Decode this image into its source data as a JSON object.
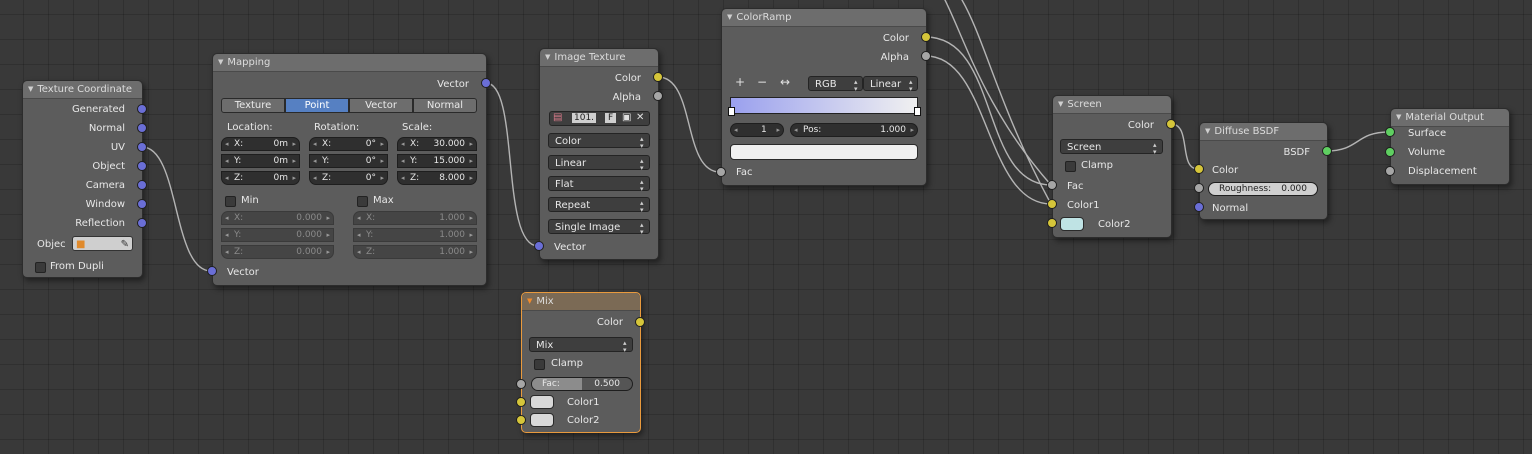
{
  "texture_coordinate": {
    "title": "Texture Coordinate",
    "outputs": [
      "Generated",
      "Normal",
      "UV",
      "Object",
      "Camera",
      "Window",
      "Reflection"
    ],
    "object_label": "Objec",
    "from_dupli_label": "From Dupli"
  },
  "mapping": {
    "title": "Mapping",
    "output": "Vector",
    "types": [
      "Texture",
      "Point",
      "Vector",
      "Normal"
    ],
    "selected_type": "Point",
    "location_label": "Location:",
    "rotation_label": "Rotation:",
    "scale_label": "Scale:",
    "location": [
      {
        "axis": "X:",
        "value": "0m"
      },
      {
        "axis": "Y:",
        "value": "0m"
      },
      {
        "axis": "Z:",
        "value": "0m"
      }
    ],
    "rotation": [
      {
        "axis": "X:",
        "value": "0°"
      },
      {
        "axis": "Y:",
        "value": "0°"
      },
      {
        "axis": "Z:",
        "value": "0°"
      }
    ],
    "scale": [
      {
        "axis": "X:",
        "value": "30.000"
      },
      {
        "axis": "Y:",
        "value": "15.000"
      },
      {
        "axis": "Z:",
        "value": "8.000"
      }
    ],
    "min_label": "Min",
    "max_label": "Max",
    "min": [
      {
        "axis": "X:",
        "value": "0.000"
      },
      {
        "axis": "Y:",
        "value": "0.000"
      },
      {
        "axis": "Z:",
        "value": "0.000"
      }
    ],
    "max": [
      {
        "axis": "X:",
        "value": "1.000"
      },
      {
        "axis": "Y:",
        "value": "1.000"
      },
      {
        "axis": "Z:",
        "value": "1.000"
      }
    ],
    "input": "Vector"
  },
  "image_texture": {
    "title": "Image Texture",
    "outputs": [
      "Color",
      "Alpha"
    ],
    "image_users": "101.",
    "fake_user": "F",
    "color_space": "Color",
    "interpolation": "Linear",
    "projection": "Flat",
    "extension": "Repeat",
    "source": "Single Image",
    "input": "Vector"
  },
  "color_ramp": {
    "title": "ColorRamp",
    "outputs": [
      "Color",
      "Alpha"
    ],
    "add": "+",
    "remove": "−",
    "flip": "↔",
    "color_mode": "RGB",
    "interpolation": "Linear",
    "stop_index": "1",
    "pos_label": "Pos:",
    "pos_value": "1.000",
    "input": "Fac",
    "gradient_start": "#9aa0ee",
    "gradient_end": "#f0f0f0"
  },
  "mix": {
    "title": "Mix",
    "output": "Color",
    "blend": "Mix",
    "clamp_label": "Clamp",
    "fac_label": "Fac:",
    "fac_value": "0.500",
    "fac_fraction": 0.5,
    "inputs": [
      "Color1",
      "Color2"
    ],
    "color1": "#d8d8d8",
    "color2": "#d8d8d8"
  },
  "screen": {
    "title": "Screen",
    "output": "Color",
    "blend": "Screen",
    "clamp_label": "Clamp",
    "inputs": [
      "Fac",
      "Color1",
      "Color2"
    ],
    "color2": "#bfe3e4"
  },
  "diffuse": {
    "title": "Diffuse BSDF",
    "output": "BSDF",
    "inputs": [
      "Color",
      "Normal"
    ],
    "roughness_label": "Roughness:",
    "roughness_value": "0.000"
  },
  "material_output": {
    "title": "Material Output",
    "inputs": [
      "Surface",
      "Volume",
      "Displacement"
    ]
  },
  "colors": {
    "canvas": "#393939",
    "node_body": "#5c5c5c",
    "vector_socket": "#6a6ed6",
    "color_socket": "#d5c53a",
    "value_socket": "#a6a6a6",
    "shader_socket": "#5fcf61",
    "selected_button": "#5680c2",
    "active_outline": "#e99a3d"
  }
}
